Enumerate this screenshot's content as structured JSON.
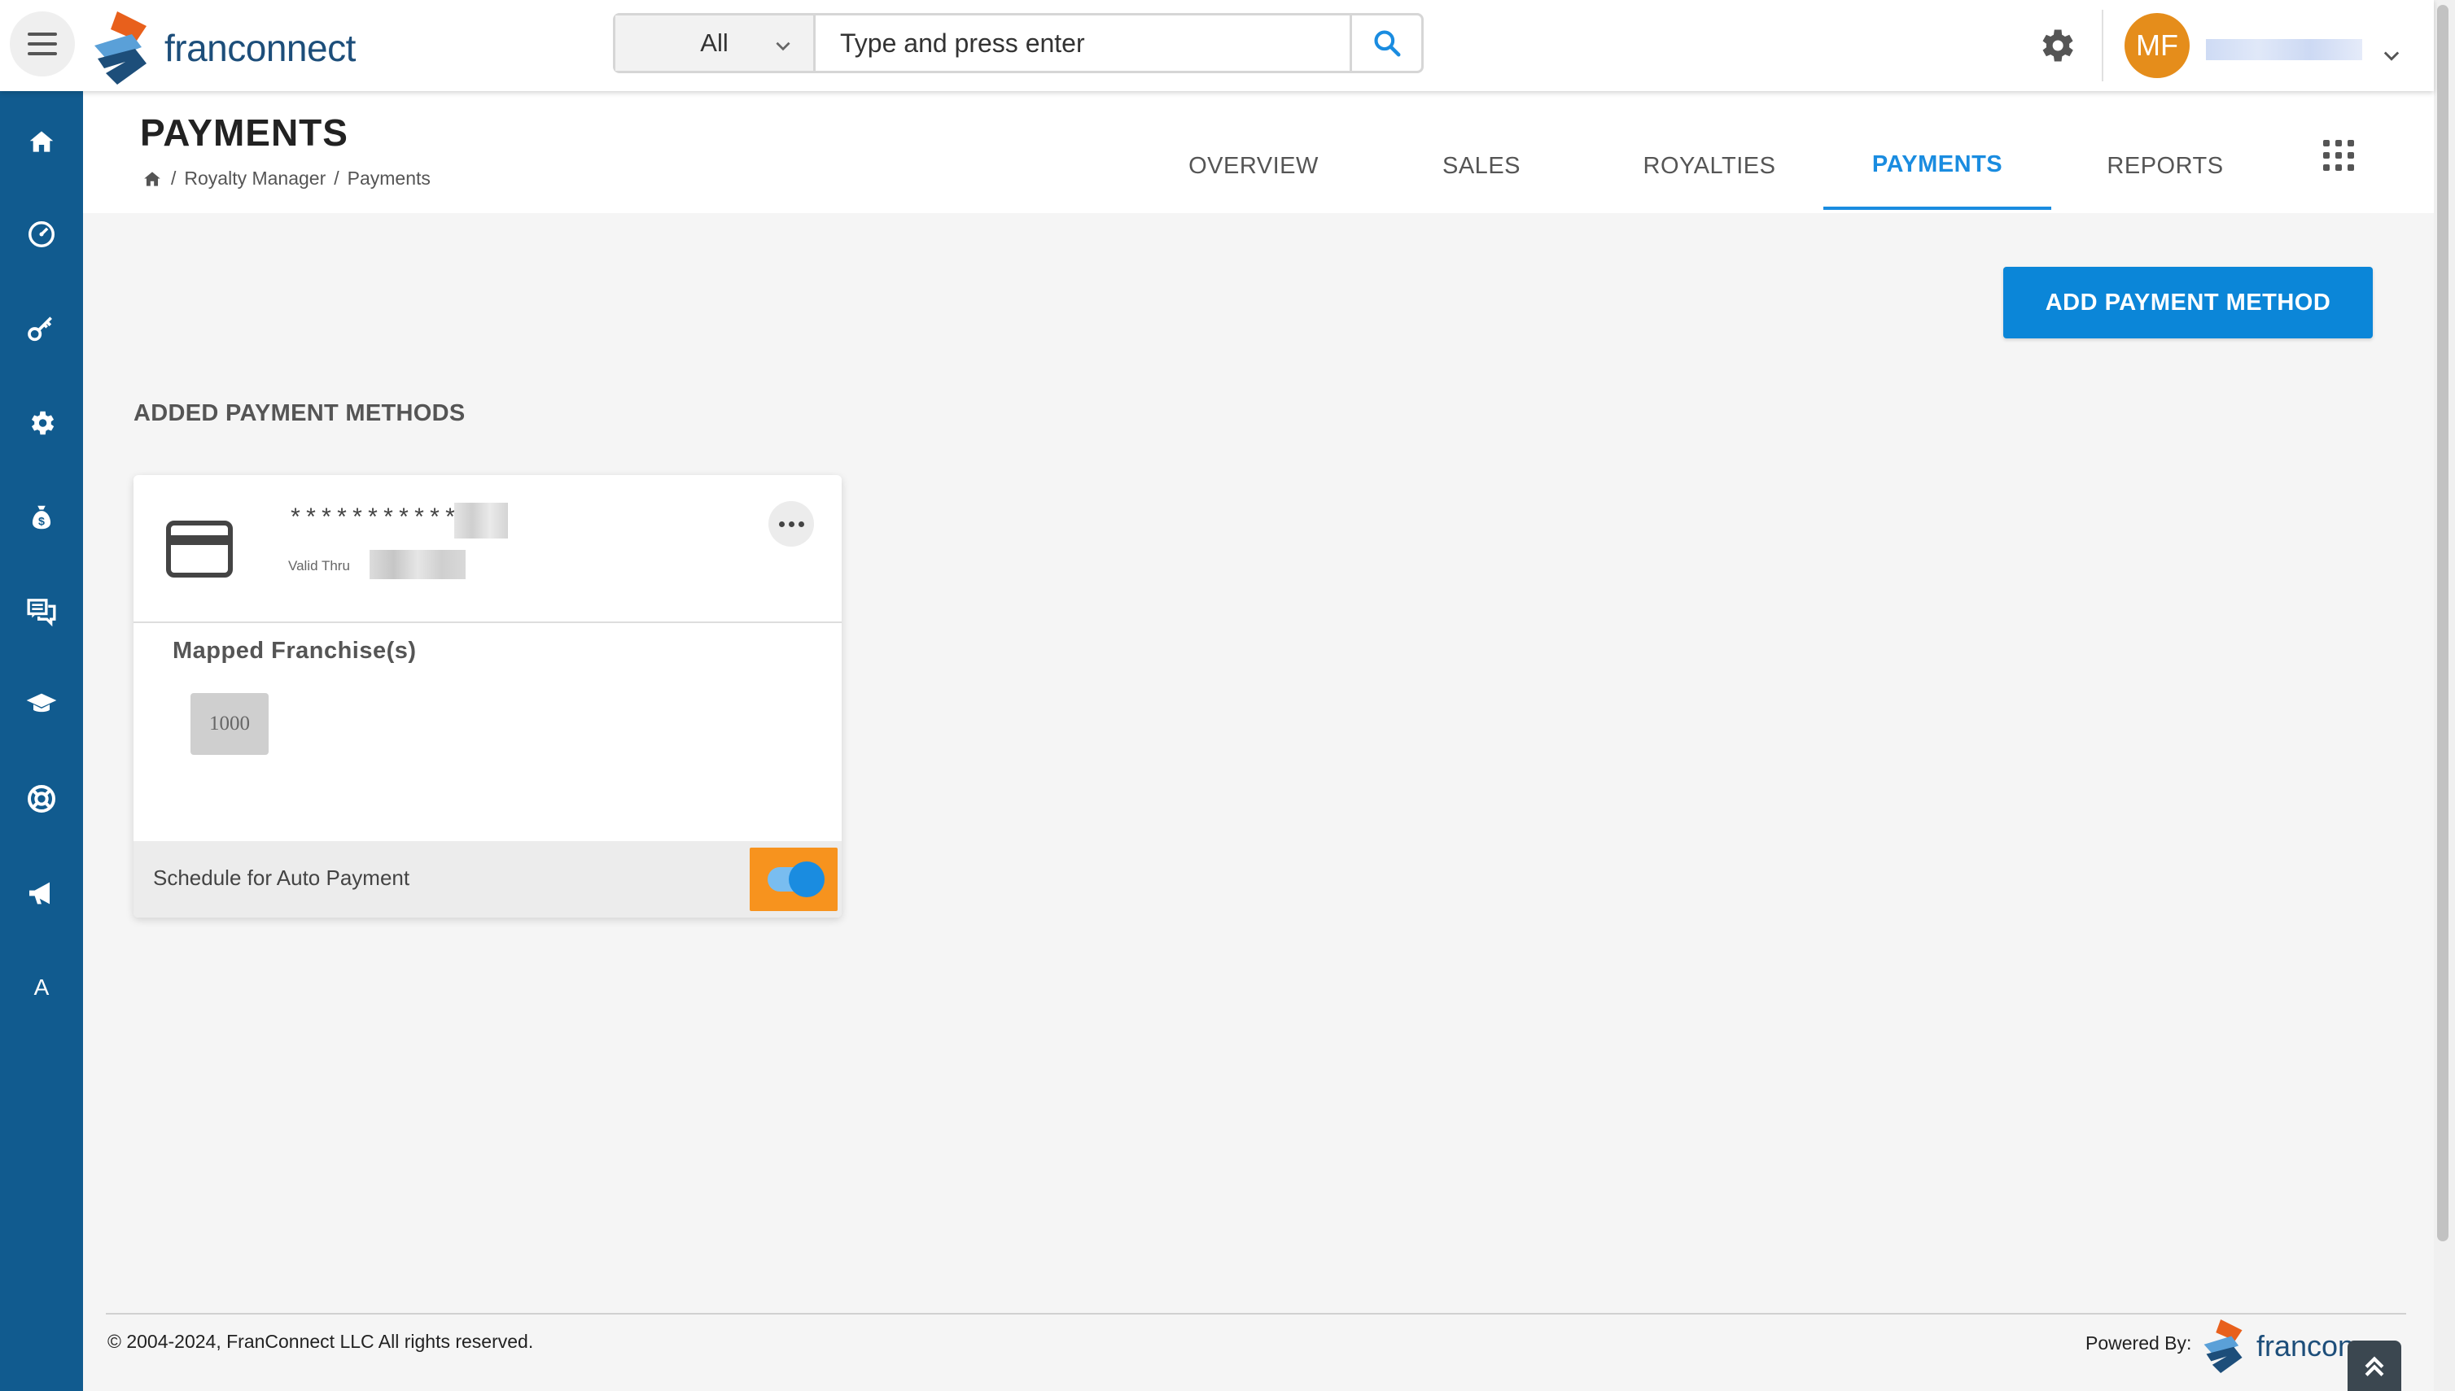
{
  "app": {
    "logo_text": "franconnect",
    "user_initials": "MF"
  },
  "search": {
    "scope": "All",
    "placeholder": "Type and press enter"
  },
  "sidebar": {
    "items": [
      {
        "icon": "home-icon"
      },
      {
        "icon": "dashboard-icon"
      },
      {
        "icon": "key-icon"
      },
      {
        "icon": "settings-icon"
      },
      {
        "icon": "money-bag-icon"
      },
      {
        "icon": "chat-icon"
      },
      {
        "icon": "graduation-cap-icon"
      },
      {
        "icon": "support-icon"
      },
      {
        "icon": "megaphone-icon"
      },
      {
        "icon": "letter-a-icon",
        "label": "A"
      }
    ]
  },
  "page": {
    "title": "PAYMENTS",
    "breadcrumb": [
      "Royalty Manager",
      "Payments"
    ]
  },
  "tabs": [
    {
      "label": "OVERVIEW",
      "active": false
    },
    {
      "label": "SALES",
      "active": false
    },
    {
      "label": "ROYALTIES",
      "active": false
    },
    {
      "label": "PAYMENTS",
      "active": true
    },
    {
      "label": "REPORTS",
      "active": false
    }
  ],
  "actions": {
    "add_payment_method": "ADD PAYMENT METHOD"
  },
  "section": {
    "added_methods_title": "ADDED PAYMENT METHODS"
  },
  "card": {
    "number_masked": "************",
    "valid_thru_label": "Valid Thru",
    "mapped_title": "Mapped Franchise(s)",
    "franchises": [
      "1000"
    ],
    "auto_payment_label": "Schedule for Auto Payment",
    "auto_payment_enabled": true
  },
  "footer": {
    "copyright": "© 2004-2024, FranConnect LLC All rights reserved.",
    "powered_by": "Powered By:",
    "powered_logo_text": "francon"
  },
  "colors": {
    "sidebar": "#115b8f",
    "accent": "#1a8ce0",
    "primary_button": "#0b86d8",
    "highlight": "#f7931e",
    "avatar": "#e58d1b"
  }
}
